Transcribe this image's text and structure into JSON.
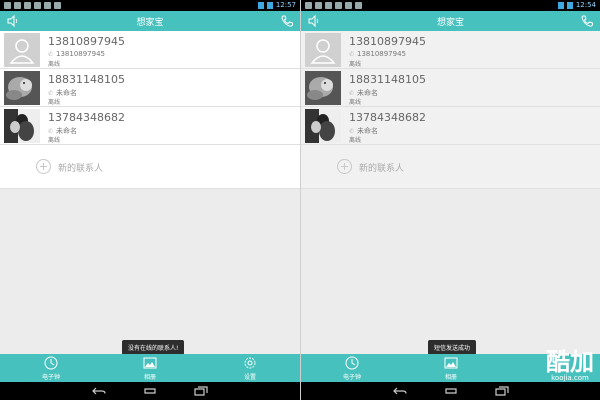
{
  "app": {
    "title": "想家宝",
    "accent_color": "#47c1bd"
  },
  "status_left": {
    "time": "12:57"
  },
  "status_right": {
    "time": "12:54"
  },
  "contacts": [
    {
      "number": "13810897945",
      "sub": "13810897945",
      "status": "离线",
      "avatar": "default-avatar"
    },
    {
      "number": "18831148105",
      "sub": "未命名",
      "status": "离线",
      "avatar": "dog-photo"
    },
    {
      "number": "13784348682",
      "sub": "未命名",
      "status": "离线",
      "avatar": "couple-photo"
    }
  ],
  "new_contact_label": "新的联系人",
  "toast_left": "没有在线的联系人!",
  "toast_right": "短信发送成功",
  "tabs_left": [
    {
      "label": "电子钟",
      "icon": "clock-icon"
    },
    {
      "label": "相册",
      "icon": "album-icon"
    },
    {
      "label": "设置",
      "icon": "settings-icon"
    }
  ],
  "tabs_right": [
    {
      "label": "电子钟",
      "icon": "clock-icon"
    },
    {
      "label": "相册",
      "icon": "album-icon"
    }
  ],
  "watermark": {
    "big": "酷加",
    "small": "koojia.com"
  }
}
